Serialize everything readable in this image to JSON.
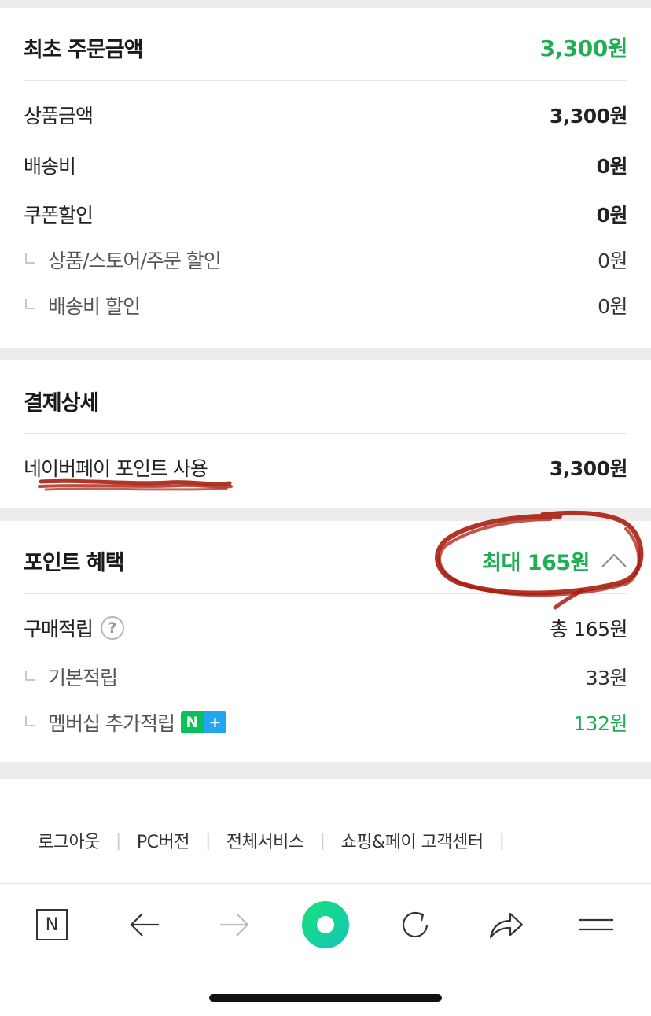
{
  "order_summary": {
    "title": "최초 주문금액",
    "total": "3,300원",
    "rows": [
      {
        "label": "상품금액",
        "value": "3,300원"
      },
      {
        "label": "배송비",
        "value": "0원"
      },
      {
        "label": "쿠폰할인",
        "value": "0원"
      }
    ],
    "sub_rows": [
      {
        "label": "상품/스토어/주문 할인",
        "value": "0원"
      },
      {
        "label": "배송비 할인",
        "value": "0원"
      }
    ]
  },
  "payment_detail": {
    "title": "결제상세",
    "label": "네이버페이 포인트 사용",
    "value": "3,300원"
  },
  "point_benefit": {
    "title": "포인트 혜택",
    "max": "최대 165원",
    "purchase_label": "구매적립",
    "purchase_total": "총 165원",
    "help_symbol": "?",
    "sub_rows": [
      {
        "label": "기본적립",
        "value": "33원"
      },
      {
        "label": "멤버십 추가적립",
        "value": "132원"
      }
    ],
    "badge_n": "N",
    "badge_plus": "+"
  },
  "footer": {
    "links": [
      "로그아웃",
      "PC버전",
      "전체서비스",
      "쇼핑&페이 고객센터"
    ]
  },
  "toolbar": {
    "home_letter": "N",
    "icons": [
      "naver-home-icon",
      "back-arrow-icon",
      "forward-arrow-icon",
      "green-dot-icon",
      "reload-icon",
      "share-icon",
      "menu-icon"
    ]
  },
  "colors": {
    "accent_green": "#1fae54",
    "scribble_red": "#a81e10"
  }
}
